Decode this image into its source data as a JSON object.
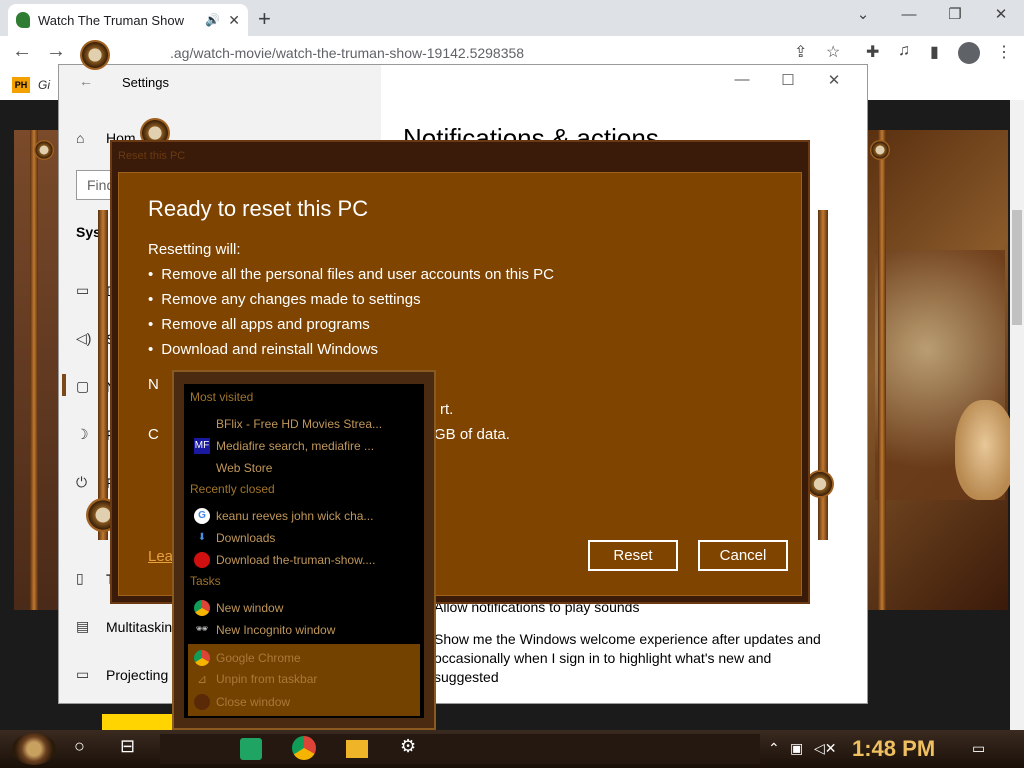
{
  "browser": {
    "tab_title": "Watch The Truman Show",
    "tab_audio_icon": "speaker-icon",
    "tab_close": "✕",
    "new_tab": "+",
    "url": ".ag/watch-movie/watch-the-truman-show-19142.5298358",
    "bookmark_label": "Gi",
    "bookmark_icon_text": "PH"
  },
  "settings": {
    "window_title": "Settings",
    "heading": "Notifications & actions",
    "search_placeholder": "Find",
    "sidebar": [
      {
        "label": "Hom",
        "icon": "home-icon"
      },
      {
        "label": "Syst",
        "icon": ""
      },
      {
        "label": "D",
        "icon": "display-icon"
      },
      {
        "label": "S",
        "icon": "sound-icon"
      },
      {
        "label": "N",
        "icon": "notifications-icon"
      },
      {
        "label": "F",
        "icon": "focus-assist-icon"
      },
      {
        "label": "P",
        "icon": "power-icon"
      },
      {
        "label": "T",
        "icon": "tablet-icon"
      },
      {
        "label": "Multitaskin",
        "icon": "multitasking-icon"
      },
      {
        "label": "Projecting",
        "icon": "projecting-icon"
      }
    ],
    "content_lines": [
      "Allow notifications to play sounds",
      "Show me the Windows welcome experience after updates and",
      "occasionally when I sign in to highlight what's new and",
      "suggested"
    ]
  },
  "reset_dialog": {
    "header": "Reset this PC",
    "title": "Ready to reset this PC",
    "intro": "Resetting will:",
    "bullets": [
      "Remove all the personal files and user accounts on this PC",
      "Remove any changes made to settings",
      "Remove all apps and programs",
      "Download and reinstall Windows"
    ],
    "partial_n": "N",
    "partial_line1": "rt.",
    "partial_line2": "GB of data.",
    "partial_c": "C",
    "learn": "Lea",
    "reset_button": "Reset",
    "cancel_button": "Cancel"
  },
  "jump_list": {
    "most_visited_label": "Most visited",
    "most_visited": [
      {
        "label": "BFlix - Free HD Movies Strea...",
        "icon": "bflix-icon"
      },
      {
        "label": "Mediafire search, mediafire ...",
        "icon": "mediafire-icon"
      },
      {
        "label": "Web Store",
        "icon": "webstore-icon"
      }
    ],
    "recently_closed_label": "Recently closed",
    "recently_closed": [
      {
        "label": "keanu reeves john wick cha...",
        "icon": "google-icon"
      },
      {
        "label": "Downloads",
        "icon": "download-icon"
      },
      {
        "label": "Download the-truman-show....",
        "icon": "mask-icon"
      }
    ],
    "tasks_label": "Tasks",
    "tasks": [
      {
        "label": "New window",
        "icon": "chrome-icon"
      },
      {
        "label": "New Incognito window",
        "icon": "incognito-icon"
      }
    ],
    "app_actions": [
      {
        "label": "Google Chrome",
        "icon": "chrome-icon"
      },
      {
        "label": "Unpin from taskbar",
        "icon": "unpin-icon"
      },
      {
        "label": "Close window",
        "icon": "close-window-icon"
      }
    ]
  },
  "taskbar": {
    "clock": "1:48 PM"
  },
  "colors": {
    "dialog_bg": "#7f4400",
    "accent": "#e8a040",
    "clock": "#f0c060"
  }
}
